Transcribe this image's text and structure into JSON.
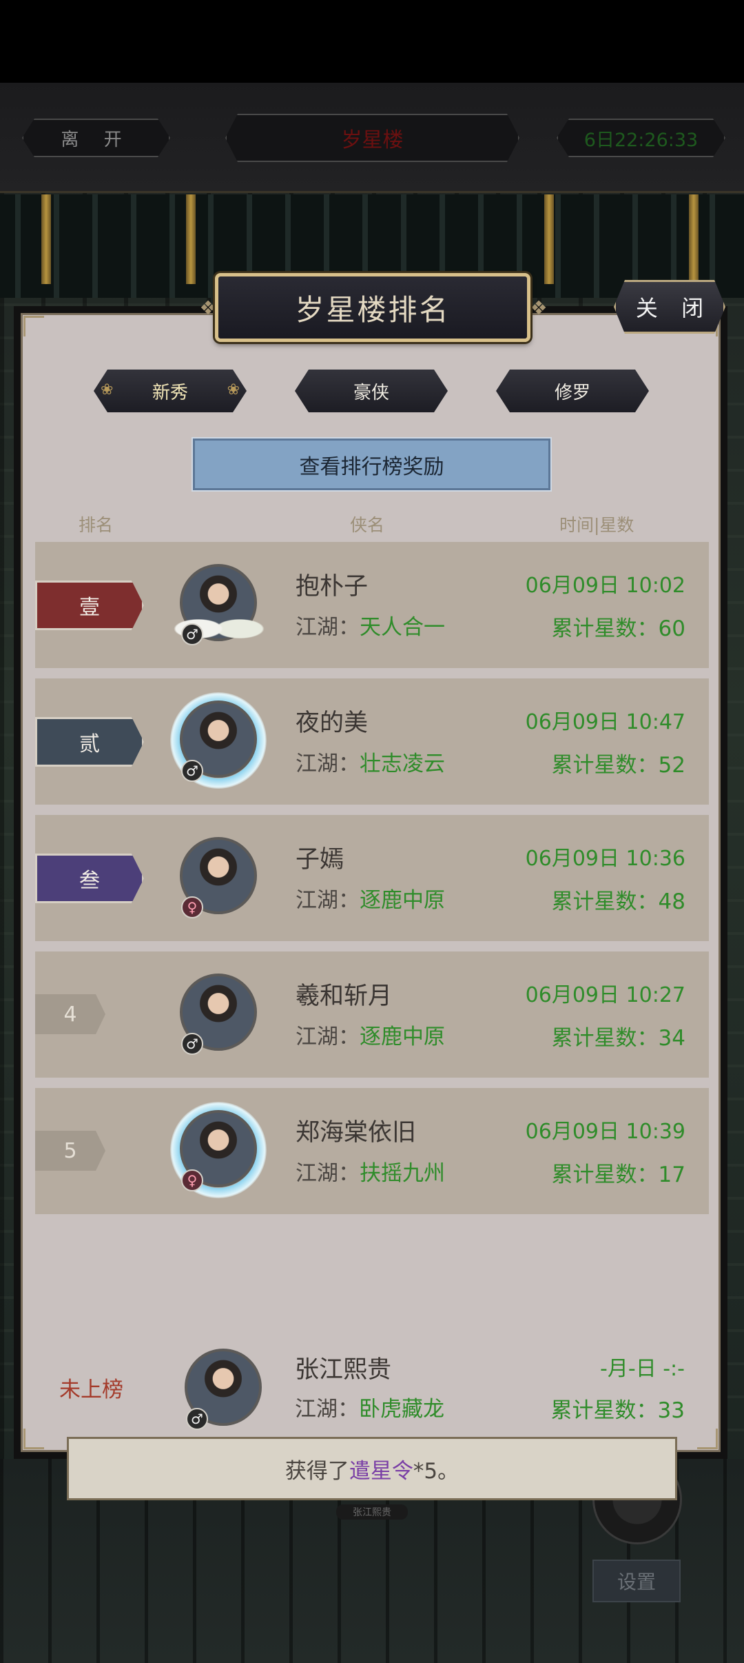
{
  "topbar": {
    "leave_label": "离 开",
    "location_label": "岁星楼",
    "time_label": "6日22:26:33"
  },
  "panel": {
    "title": "岁星楼排名",
    "close_label": "关 闭"
  },
  "tabs": [
    {
      "label": "新秀",
      "active": true
    },
    {
      "label": "豪侠",
      "active": false
    },
    {
      "label": "修罗",
      "active": false
    }
  ],
  "reward_button_label": "查看排行榜奖励",
  "columns": {
    "rank": "排名",
    "name": "侠名",
    "time_stars": "时间|星数"
  },
  "jianghu_label": "江湖：",
  "stars_label": "累计星数：",
  "rankings": [
    {
      "rank": "壹",
      "name": "抱朴子",
      "jianghu": "天人合一",
      "time": "06月09日 10:02",
      "stars": "60",
      "gender": "♂"
    },
    {
      "rank": "贰",
      "name": "夜的美",
      "jianghu": "壮志凌云",
      "time": "06月09日 10:47",
      "stars": "52",
      "gender": "♂"
    },
    {
      "rank": "叁",
      "name": "子嫣",
      "jianghu": "逐鹿中原",
      "time": "06月09日 10:36",
      "stars": "48",
      "gender": "♀"
    },
    {
      "rank": "4",
      "name": "羲和斩月",
      "jianghu": "逐鹿中原",
      "time": "06月09日 10:27",
      "stars": "34",
      "gender": "♂"
    },
    {
      "rank": "5",
      "name": "郑海棠依旧",
      "jianghu": "扶摇九州",
      "time": "06月09日 10:39",
      "stars": "17",
      "gender": "♀"
    }
  ],
  "self": {
    "rank_label": "未上榜",
    "name": "张江熙贵",
    "jianghu": "卧虎藏龙",
    "time": "-月-日 -:-",
    "stars": "33",
    "gender": "♂"
  },
  "toast": {
    "prefix": "获得了",
    "item": "遣星令",
    "suffix": "*5。"
  },
  "scene": {
    "player_tag": "张江熙贵",
    "settings_label": "设置"
  },
  "colors": {
    "accent_green": "#2f8c2a",
    "rank1": "#7e2e2e",
    "rank2": "#3f4b58",
    "rank3": "#4c3f79",
    "item_purple": "#7a3fa6"
  }
}
